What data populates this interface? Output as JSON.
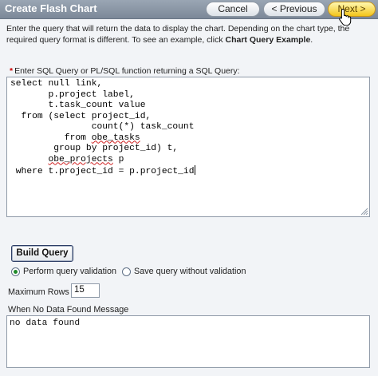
{
  "header": {
    "title": "Create Flash Chart",
    "cancel_label": "Cancel",
    "previous_label": "< Previous",
    "next_label": "Next >"
  },
  "intro": {
    "text_before": "Enter the query that will return the data to display the chart. Depending on the chart type, the required query format is different. To see an example, click ",
    "link_text": "Chart Query Example",
    "text_after": "."
  },
  "sql": {
    "label": "Enter SQL Query or PL/SQL function returning a SQL Query:",
    "lines": [
      "select null link,",
      "       p.project label,",
      "       t.task_count value",
      "  from (select project_id,",
      "               count(*) task_count",
      "          from ",
      "        group by project_id) t,",
      "       ",
      " where t.project_id = p.project_id"
    ],
    "line6_squiggle": "obe_tasks",
    "line8_squiggle": "obe_projects",
    "line8_rest": " p"
  },
  "build_query_label": "Build Query",
  "validation": {
    "option_1": "Perform query validation",
    "option_2": "Save query without validation",
    "selected": "option_1"
  },
  "max_rows": {
    "label": "Maximum Rows",
    "value": "15"
  },
  "no_data": {
    "label": "When No Data Found Message",
    "value": "no data found"
  },
  "colors": {
    "header_bg": "#8a96a6",
    "next_button": "#f3c41a",
    "required_star": "#cc0000"
  },
  "icons": {
    "cursor": "hand-pointer-icon",
    "grip": "resize-grip-icon"
  }
}
